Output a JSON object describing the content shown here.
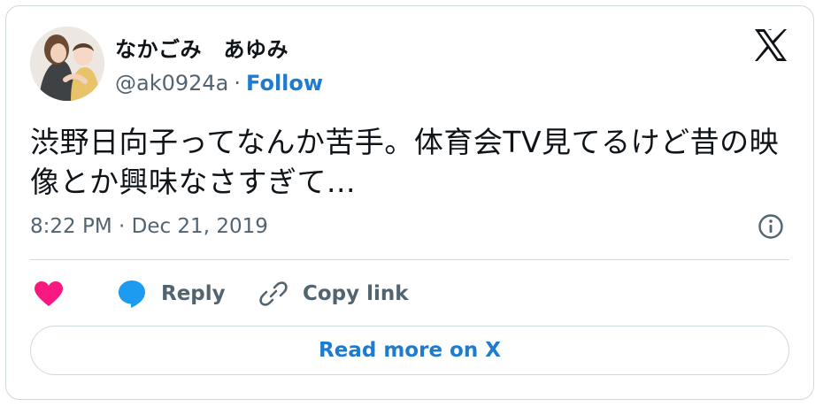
{
  "author": {
    "display_name": "なかごみ　あゆみ",
    "handle": "@ak0924a",
    "separator": "·",
    "follow_label": "Follow",
    "avatar_icon": "user-avatar"
  },
  "brand": {
    "logo_icon": "x-logo-icon"
  },
  "tweet": {
    "text": "渋野日向子ってなんか苦手。体育会TV見てるけど昔の映像とか興味なさすぎて...",
    "timestamp": "8:22 PM · Dec 21, 2019"
  },
  "actions": {
    "like_icon": "heart-icon",
    "reply_label": "Reply",
    "reply_icon": "speech-bubble-icon",
    "copy_label": "Copy link",
    "copy_icon": "link-icon"
  },
  "read_more_label": "Read more on X",
  "colors": {
    "accent": "#1d7bd0",
    "like": "#f91880",
    "reply": "#1d9bf0",
    "muted": "#536471",
    "border": "#cfd9de",
    "text": "#0f1419"
  }
}
